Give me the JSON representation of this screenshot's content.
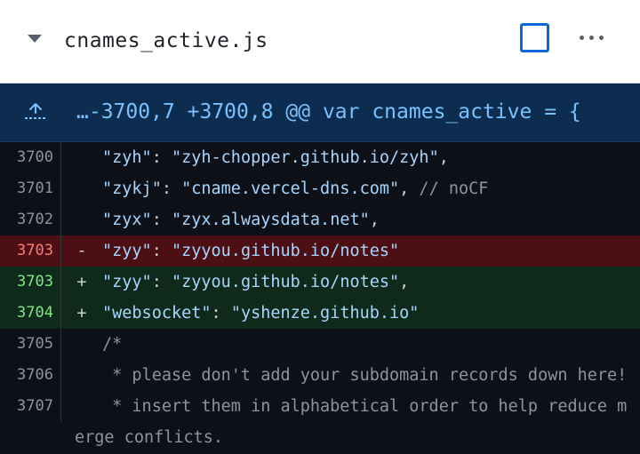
{
  "file": {
    "name": "cnames_active.js",
    "collapse_icon": "chevron-down-icon",
    "viewed_checkbox": false,
    "menu_icon": "kebab-horizontal-icon"
  },
  "hunk": {
    "expand_icon": "expand-up-icon",
    "header": "…-3700,7 +3700,8 @@ var cnames_active = {"
  },
  "lines": [
    {
      "num": "3700",
      "marker": "",
      "type": "ctx",
      "key": "\"zyh\"",
      "val": "\"zyh-chopper.github.io/zyh\"",
      "tail": ",",
      "comment": ""
    },
    {
      "num": "3701",
      "marker": "",
      "type": "ctx",
      "key": "\"zykj\"",
      "val": "\"cname.vercel-dns.com\"",
      "tail": ",",
      "comment": " // noCF"
    },
    {
      "num": "3702",
      "marker": "",
      "type": "ctx",
      "key": "\"zyx\"",
      "val": "\"zyx.alwaysdata.net\"",
      "tail": ",",
      "comment": ""
    },
    {
      "num": "3703",
      "marker": "-",
      "type": "del",
      "key": "\"zyy\"",
      "val": "\"zyyou.github.io/notes\"",
      "tail": "",
      "comment": ""
    },
    {
      "num": "3703",
      "marker": "+",
      "type": "add",
      "key": "\"zyy\"",
      "val": "\"zyyou.github.io/notes\"",
      "tail": ",",
      "comment": ""
    },
    {
      "num": "3704",
      "marker": "+",
      "type": "add",
      "key": "\"websocket\"",
      "val": "\"yshenze.github.io\"",
      "tail": "",
      "comment": ""
    }
  ],
  "comment_lines": [
    {
      "num": "3705",
      "text": "/*"
    },
    {
      "num": "3706",
      "text": " * please don't add your subdomain records down here!"
    },
    {
      "num": "3707",
      "text": " * insert them in alphabetical order to help reduce m"
    }
  ],
  "wrapped_continuation": "erge conflicts.",
  "colors": {
    "hunk_bg": "#0c2d4f",
    "deletion_bg": "#4b0f14",
    "addition_bg": "#0f2a1a",
    "accent": "#0969da"
  }
}
